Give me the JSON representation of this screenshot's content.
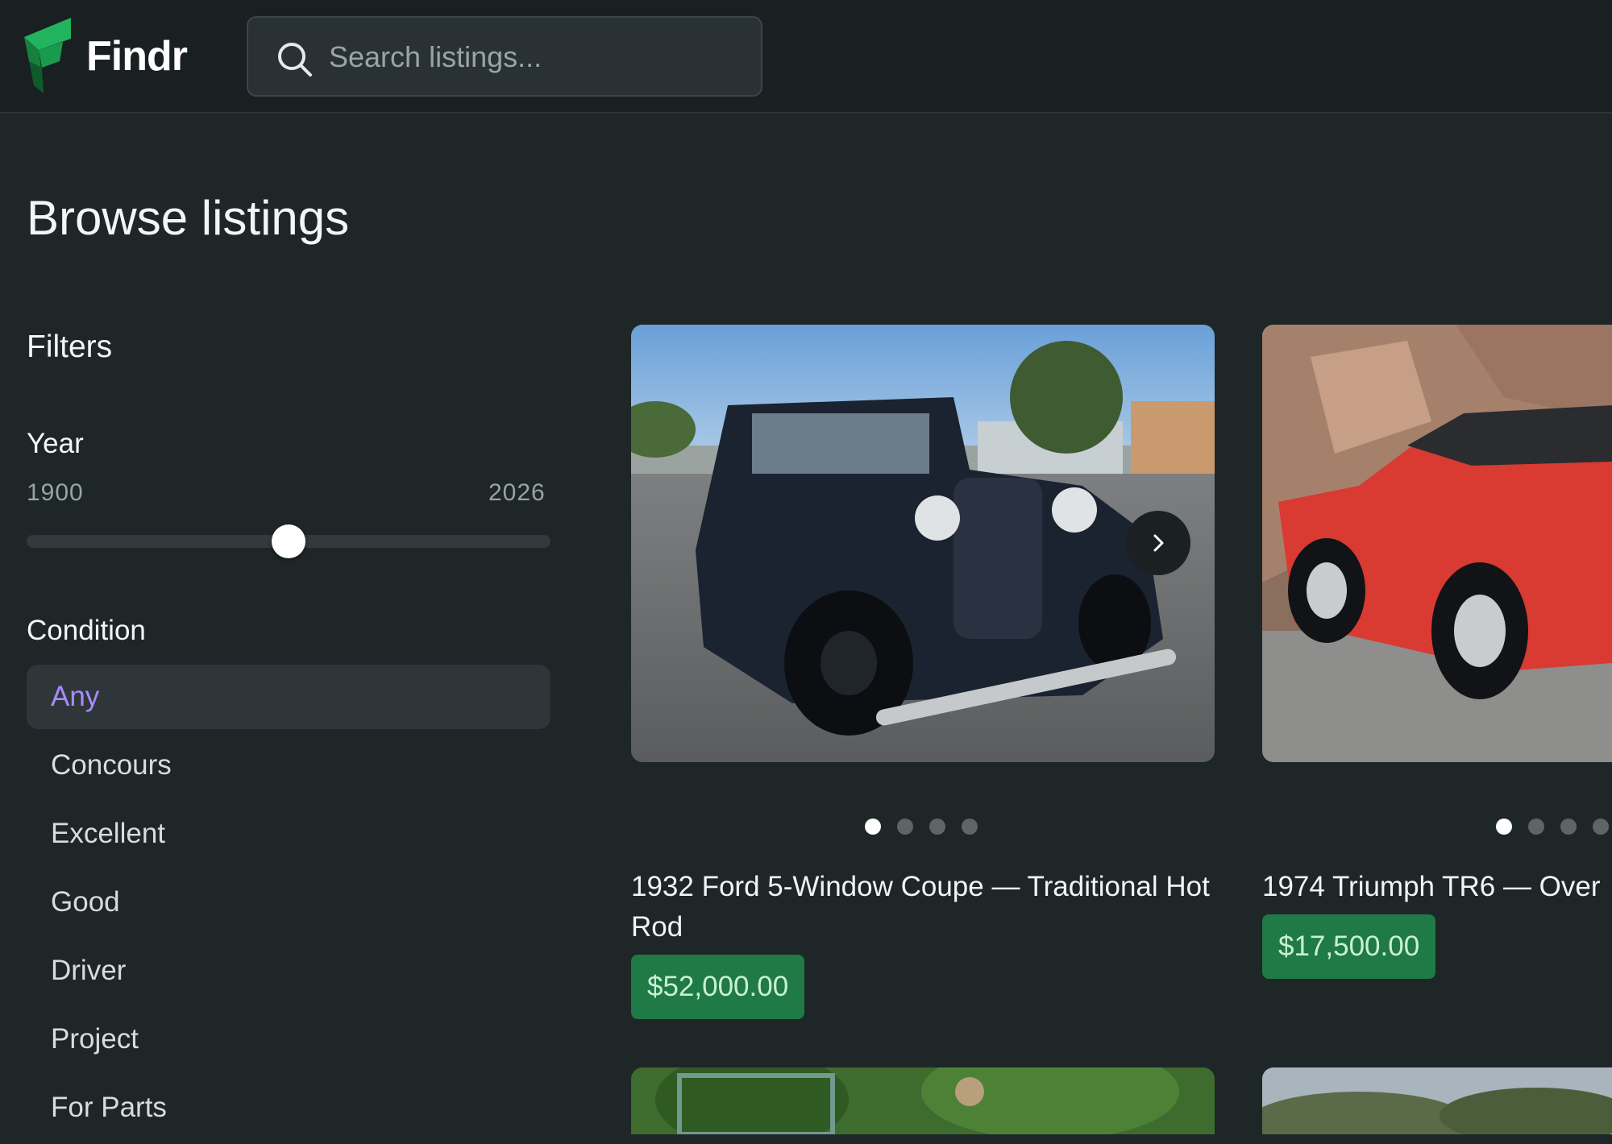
{
  "app": {
    "brand": "Findr"
  },
  "search": {
    "placeholder": "Search listings...",
    "value": ""
  },
  "page": {
    "title": "Browse listings"
  },
  "filters": {
    "title": "Filters",
    "year": {
      "label": "Year",
      "min": "1900",
      "max": "2026",
      "value_fraction": 0.5
    },
    "condition": {
      "label": "Condition",
      "selected": "Any",
      "options": [
        "Any",
        "Concours",
        "Excellent",
        "Good",
        "Driver",
        "Project",
        "For Parts"
      ]
    }
  },
  "listings": [
    {
      "title": "1932 Ford 5-Window Coupe — Traditional Hot Rod",
      "price": "$52,000.00",
      "image_count": 4,
      "image_index": 0,
      "image": "black vintage coupe in parking lot"
    },
    {
      "title": "1974 Triumph TR6 — Over",
      "price": "$17,500.00",
      "image_count": 4,
      "image_index": 0,
      "image": "red convertible by rocky hillside"
    }
  ],
  "colors": {
    "background": "#1f2628",
    "header": "#1a1f21",
    "accent_purple": "#a98bff",
    "price_green": "#1f7a45",
    "logo_green": "#22b35e"
  }
}
